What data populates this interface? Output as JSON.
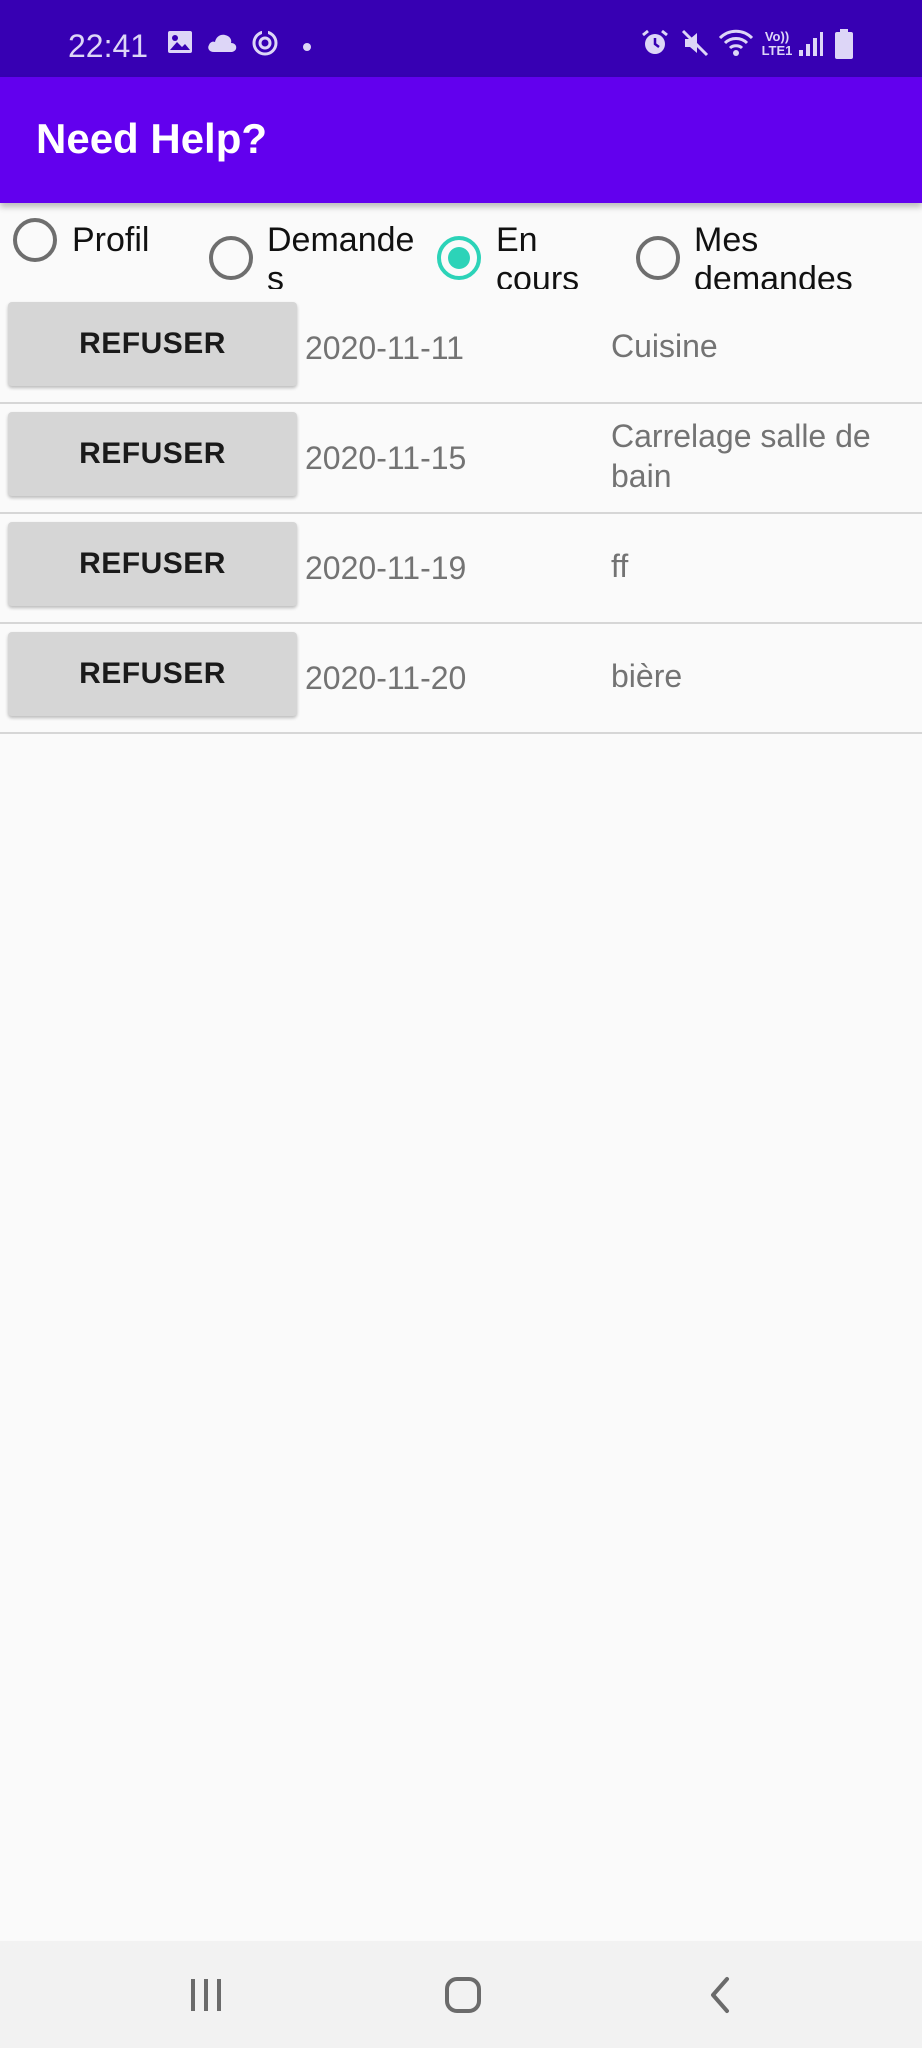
{
  "status_bar": {
    "time": "22:41",
    "left_icons": [
      "gallery-icon",
      "cloud-icon",
      "sync-icon",
      "dot-icon"
    ],
    "right_icons": [
      "alarm-icon",
      "mute-icon",
      "wifi-icon",
      "volte-icon",
      "signal-icon",
      "battery-icon"
    ],
    "volte_label_top": "Vo))",
    "volte_label_bottom": "LTE1"
  },
  "app_bar": {
    "title": "Need Help?",
    "color": "#6200ee"
  },
  "tabs": [
    {
      "label": "Profil",
      "checked": false
    },
    {
      "label": "Demande\ns",
      "checked": false
    },
    {
      "label": "En\ncours",
      "checked": true
    },
    {
      "label": "Mes\ndemandes",
      "checked": false
    }
  ],
  "accent_color": "#2cd3b8",
  "rows": [
    {
      "button": "REFUSER",
      "date": "2020-11-11",
      "description": "Cuisine"
    },
    {
      "button": "REFUSER",
      "date": "2020-11-15",
      "description": "Carrelage salle de bain"
    },
    {
      "button": "REFUSER",
      "date": "2020-11-19",
      "description": "ff"
    },
    {
      "button": "REFUSER",
      "date": "2020-11-20",
      "description": "bière"
    }
  ],
  "nav_bar": {
    "icons": [
      "recent-apps-icon",
      "home-icon",
      "back-icon"
    ]
  }
}
